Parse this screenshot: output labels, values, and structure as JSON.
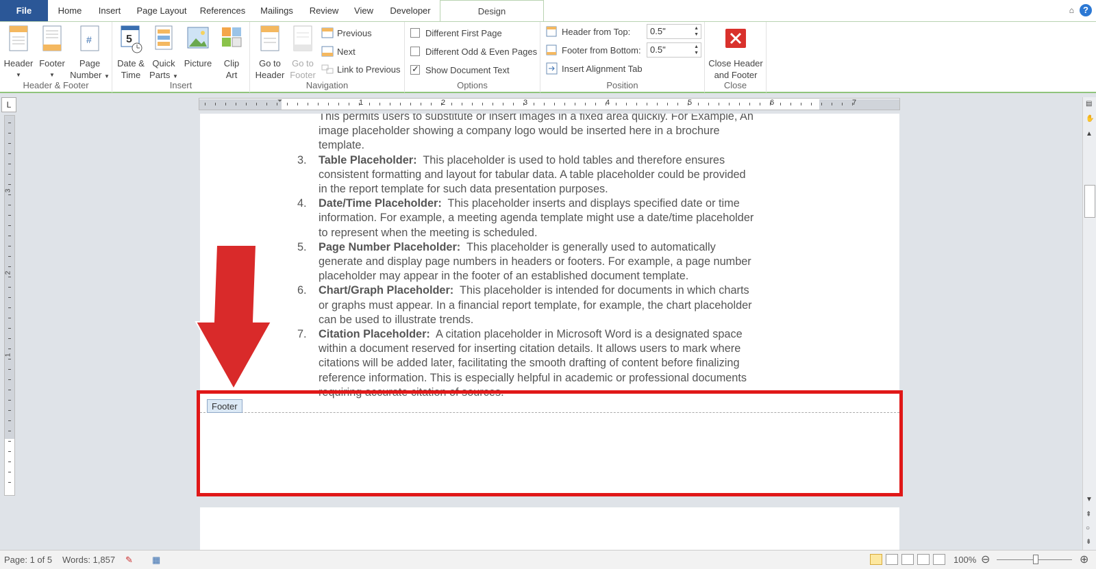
{
  "tabs": {
    "file": "File",
    "home": "Home",
    "insert": "Insert",
    "page_layout": "Page Layout",
    "references": "References",
    "mailings": "Mailings",
    "review": "Review",
    "view": "View",
    "developer": "Developer",
    "design": "Design"
  },
  "help_label": "?",
  "ribbon": {
    "header_footer": {
      "label": "Header & Footer",
      "header_btn": "Header",
      "footer_btn": "Footer",
      "page_number_1": "Page",
      "page_number_2": "Number"
    },
    "insert": {
      "label": "Insert",
      "date_time_1": "Date &",
      "date_time_2": "Time",
      "quick_parts_1": "Quick",
      "quick_parts_2": "Parts",
      "picture": "Picture",
      "clip_art_1": "Clip",
      "clip_art_2": "Art"
    },
    "navigation": {
      "label": "Navigation",
      "goto_header_1": "Go to",
      "goto_header_2": "Header",
      "goto_footer_1": "Go to",
      "goto_footer_2": "Footer",
      "previous": "Previous",
      "next": "Next",
      "link_previous": "Link to Previous"
    },
    "options": {
      "label": "Options",
      "different_first": "Different First Page",
      "different_odd_even": "Different Odd & Even Pages",
      "show_doc_text": "Show Document Text",
      "different_first_checked": false,
      "different_odd_even_checked": false,
      "show_doc_text_checked": true
    },
    "position": {
      "label": "Position",
      "header_from_top_label": "Header from Top:",
      "header_from_top": "0.5\"",
      "footer_from_bottom_label": "Footer from Bottom:",
      "footer_from_bottom": "0.5\"",
      "insert_alignment_tab": "Insert Alignment Tab"
    },
    "close": {
      "label": "Close",
      "close_btn_1": "Close Header",
      "close_btn_2": "and Footer"
    }
  },
  "ruler": {
    "corner": "L",
    "numbers": [
      "1",
      "2",
      "3",
      "4",
      "5",
      "6",
      "7"
    ],
    "vnumbers": [
      "3",
      "2",
      "1"
    ]
  },
  "document": {
    "intro_lines": [
      "This permits users to substitute or insert images in a fixed area quickly. For Example, An",
      "image placeholder showing a company logo would be inserted here in a brochure",
      "template."
    ],
    "items": [
      {
        "num": "3.",
        "title": "Table Placeholder:",
        "lines": [
          "This placeholder is used to hold tables and therefore ensures",
          "consistent formatting and layout for tabular data. A table placeholder could be provided",
          "in the report template for such data presentation purposes."
        ]
      },
      {
        "num": "4.",
        "title": "Date/Time Placeholder:",
        "lines": [
          "This placeholder inserts and displays specified date or time",
          "information. For example, a meeting agenda template might use a date/time placeholder",
          "to represent when the meeting is scheduled."
        ]
      },
      {
        "num": "5.",
        "title": "Page Number Placeholder:",
        "lines": [
          "This placeholder is generally used to automatically",
          "generate and display page numbers in headers or footers. For example, a page number",
          "placeholder may appear in the footer of an established document template."
        ]
      },
      {
        "num": "6.",
        "title": "Chart/Graph Placeholder:",
        "lines": [
          "This placeholder is intended for documents in which charts",
          "or graphs must appear. In a financial report template, for example, the chart placeholder",
          "can be used to illustrate trends."
        ]
      },
      {
        "num": "7.",
        "title": "Citation Placeholder:",
        "lines": [
          "A citation placeholder in Microsoft Word is a designated space",
          "within a document reserved for inserting citation details. It allows users to mark where",
          "citations will be added later, facilitating the smooth drafting of content before finalizing",
          "reference information. This is especially helpful in academic or professional documents",
          "requiring accurate citation of sources."
        ]
      }
    ],
    "footer_tag": "Footer"
  },
  "status": {
    "page": "Page: 1 of 5",
    "words": "Words: 1,857",
    "zoom": "100%"
  },
  "colors": {
    "file_tab": "#2b5797",
    "highlight_box": "#e01818",
    "arrow": "#d92a2a",
    "ribbon_accent": "#8fc47c"
  }
}
